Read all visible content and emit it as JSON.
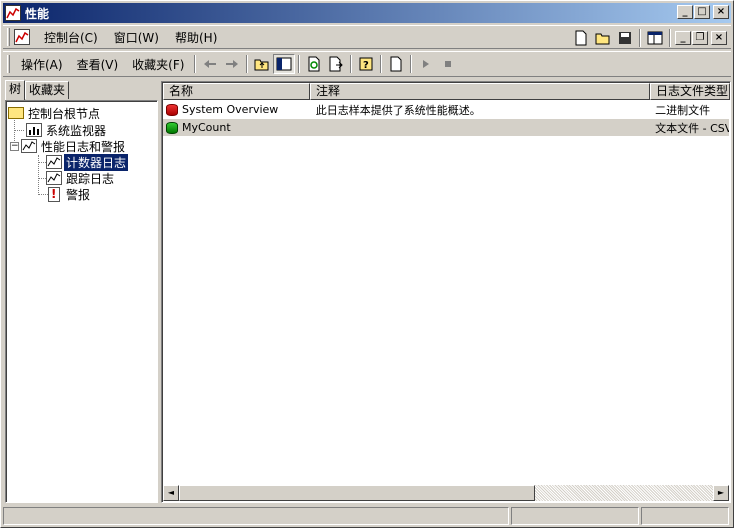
{
  "window": {
    "title": "性能"
  },
  "menubar": {
    "items": [
      "控制台(C)",
      "窗口(W)",
      "帮助(H)"
    ]
  },
  "toolbar": {
    "menus": [
      "操作(A)",
      "查看(V)",
      "收藏夹(F)"
    ]
  },
  "tabs": [
    "树",
    "收藏夹"
  ],
  "tree": {
    "root": "控制台根节点",
    "sysmon": "系统监视器",
    "perflogs": "性能日志和警报",
    "counter": "计数器日志",
    "trace": "跟踪日志",
    "alerts": "警报",
    "expander_symbol": "−"
  },
  "list": {
    "columns": [
      "名称",
      "注释",
      "日志文件类型"
    ],
    "rows": [
      {
        "name": "System Overview",
        "comment": "此日志样本提供了系统性能概述。",
        "type": "二进制文件",
        "status": "red"
      },
      {
        "name": "MyCount",
        "comment": "",
        "type": "文本文件 - CSV",
        "status": "green"
      }
    ]
  },
  "colors": {
    "title_start": "#0a246a",
    "title_end": "#a6caf0",
    "selection": "#0a246a"
  }
}
